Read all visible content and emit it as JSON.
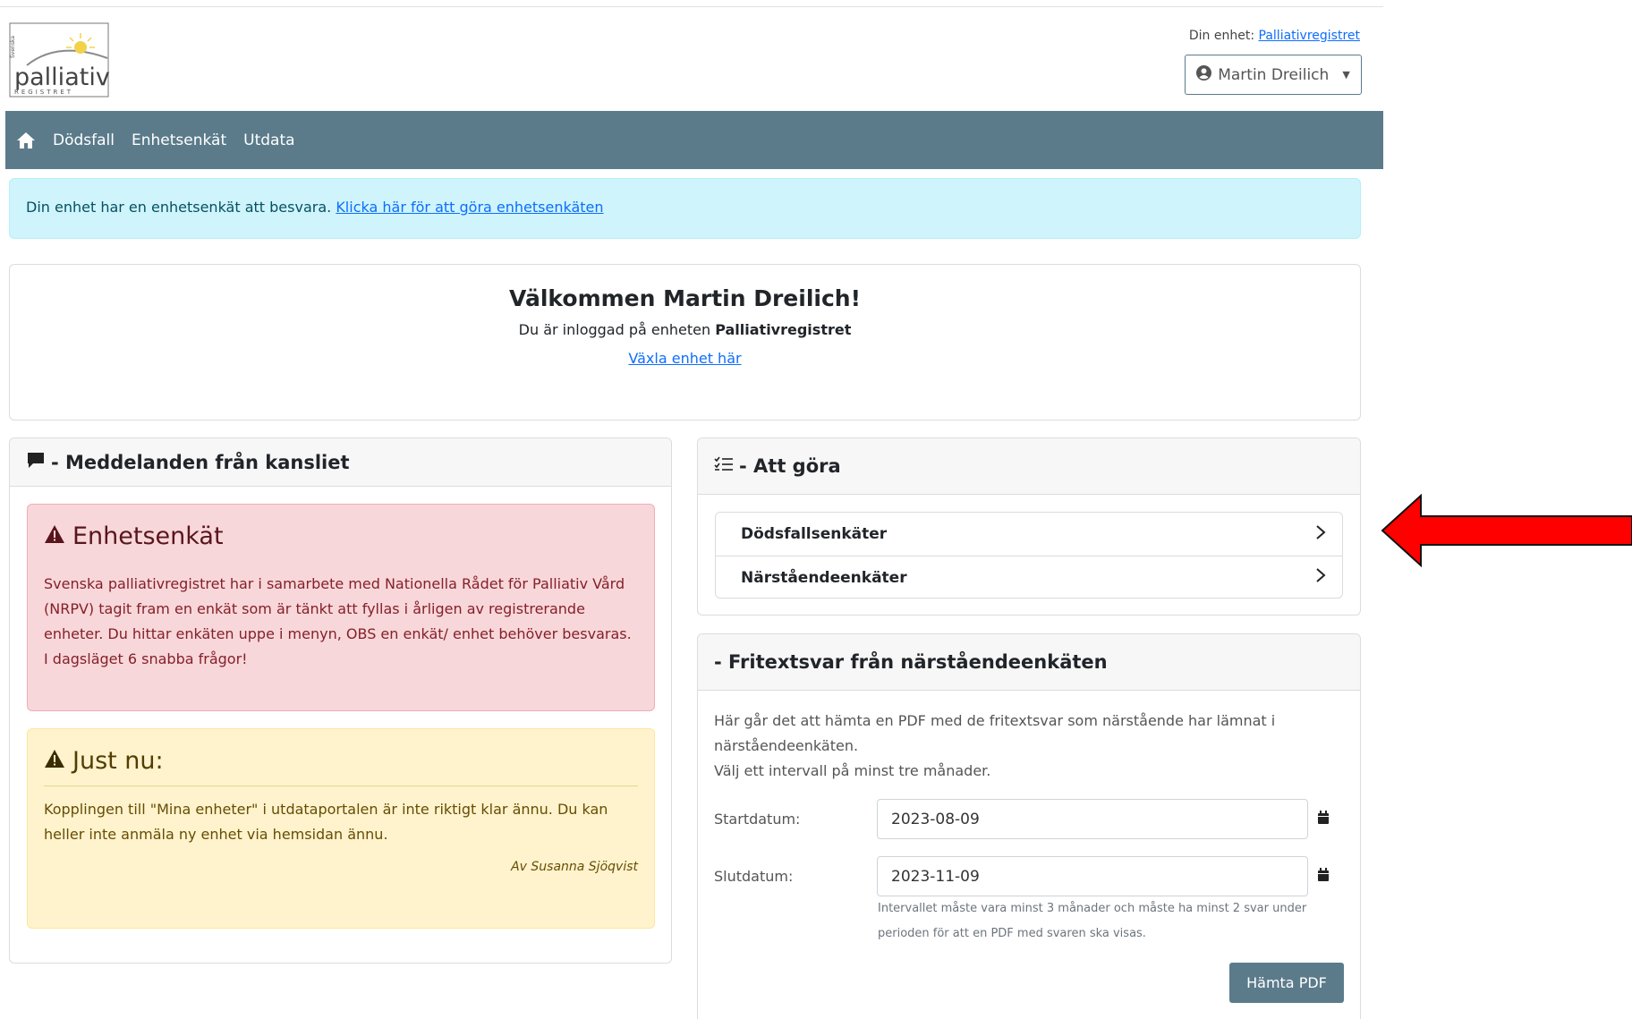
{
  "logo": {
    "top_text": "Svenska",
    "main_text": "palliativ",
    "bottom_text": "REGISTRET"
  },
  "header": {
    "unit_label": "Din enhet:",
    "unit_link": "Palliativregistret",
    "user_name": "Martin Dreilich"
  },
  "nav": {
    "items": [
      {
        "label": "Dödsfall"
      },
      {
        "label": "Enhetsenkät"
      },
      {
        "label": "Utdata"
      }
    ]
  },
  "alert_info": {
    "text": "Din enhet har en enhetsenkät att besvara. ",
    "link": "Klicka här för att göra enhetsenkäten"
  },
  "welcome": {
    "title": "Välkommen Martin Dreilich!",
    "sub_prefix": "Du är inloggad på enheten ",
    "sub_unit": "Palliativregistret",
    "switch_link": "Växla enhet här"
  },
  "messages": {
    "header": "- Meddelanden från kansliet",
    "alert1": {
      "title": "Enhetsenkät",
      "text": "Svenska palliativregistret har i samarbete med Nationella Rådet för Palliativ Vård (NRPV) tagit fram en enkät som är tänkt att fyllas i årligen av registrerande enheter. Du hittar enkäten uppe i menyn, OBS en enkät/ enhet behöver besvaras. I dagsläget 6 snabba frågor!"
    },
    "alert2": {
      "title": "Just nu:",
      "text": "Kopplingen till \"Mina enheter\" i utdataportalen är inte riktigt klar ännu. Du kan heller inte anmäla ny enhet via hemsidan ännu.",
      "author": "Av Susanna Sjöqvist"
    }
  },
  "todo": {
    "header": "- Att göra",
    "items": [
      {
        "label": "Dödsfallsenkäter"
      },
      {
        "label": "Närståendeenkäter"
      }
    ]
  },
  "freetext": {
    "header": "- Fritextsvar från närståendeenkäten",
    "description": "Här går det att hämta en PDF med de fritextsvar som närstående har lämnat i närståendeenkäten.",
    "instruction": "Välj ett intervall på minst tre månader.",
    "start_label": "Startdatum:",
    "start_value": "2023-08-09",
    "end_label": "Slutdatum:",
    "end_value": "2023-11-09",
    "hint": "Intervallet måste vara minst 3 månader och måste ha minst 2 svar under perioden för att en PDF med svaren ska visas.",
    "button": "Hämta PDF"
  },
  "colors": {
    "nav_bg": "#5b7b8b",
    "info_bg": "#cff4fc",
    "danger_bg": "#f8d7da",
    "warning_bg": "#fff3cd",
    "arrow": "#ff0000"
  }
}
